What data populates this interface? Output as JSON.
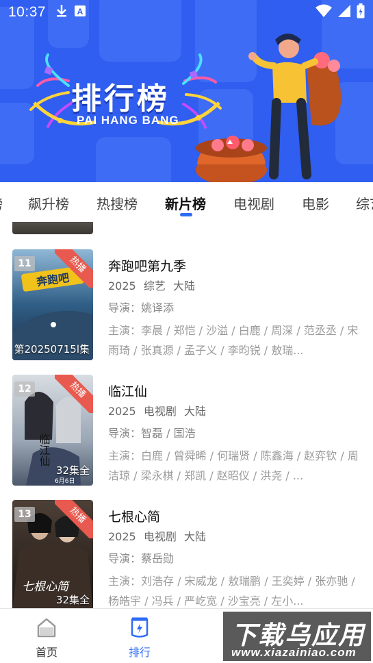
{
  "status_bar": {
    "time": "10:37",
    "left_icons": [
      "download-icon",
      "a-notification-icon"
    ],
    "right_icons": [
      "wifi-icon",
      "signal-icon",
      "battery-icon"
    ]
  },
  "banner": {
    "title": "排行榜",
    "subtitle": "PAI HANG BANG"
  },
  "tabs": [
    {
      "label": "榜"
    },
    {
      "label": "飙升榜"
    },
    {
      "label": "热搜榜"
    },
    {
      "label": "新片榜",
      "active": true
    },
    {
      "label": "电视剧"
    },
    {
      "label": "电影"
    },
    {
      "label": "综艺"
    }
  ],
  "items": [
    {
      "rank": "11",
      "badge": "热播",
      "title": "奔跑吧第九季",
      "year": "2025",
      "genre": "综艺",
      "region": "大陆",
      "director": "导演：姚译添",
      "cast": "主演：李晨 / 郑恺 / 沙溢 / 白鹿 / 周深 / 范丞丞 / 宋雨琦 / 张真源 / 孟子义 / 李昀锐 / 敖瑞...",
      "episode": "第20250715l集",
      "poster_logo": "奔跑吧"
    },
    {
      "rank": "12",
      "badge": "热播",
      "title": "临江仙",
      "year": "2025",
      "genre": "电视剧",
      "region": "大陆",
      "director": "导演：智磊 / 国浩",
      "cast": "主演：白鹿 / 曾舜晞 / 何瑞贤 / 陈鑫海 / 赵弈钦 / 周洁琼 / 梁永棋 / 郑凯 / 赵昭仪 / 洪尧 / ...",
      "episode": "32集全",
      "poster_logo": "临江仙",
      "poster_date": "6月6日"
    },
    {
      "rank": "13",
      "badge": "热播",
      "title": "七根心简",
      "year": "2025",
      "genre": "电视剧",
      "region": "大陆",
      "director": "导演：蔡岳勋",
      "cast": "主演：刘浩存 / 宋威龙 / 敖瑞鹏 / 王奕婷 / 张亦驰 / 杨皓宇 / 冯兵 / 严屹宽 / 沙宝亮 / 左小...",
      "episode": "32集全",
      "poster_logo": "七根心简"
    }
  ],
  "bottom_nav": [
    {
      "label": "首页",
      "icon": "home-icon"
    },
    {
      "label": "排行",
      "icon": "ranking-icon",
      "active": true
    }
  ],
  "watermark": {
    "cn": "下载乌应用",
    "en": "www.xiazainiao.com"
  },
  "colors": {
    "banner_blue": "#2f5ef0",
    "accent": "#2f6cf4",
    "hot_badge": "#e85a4f"
  }
}
